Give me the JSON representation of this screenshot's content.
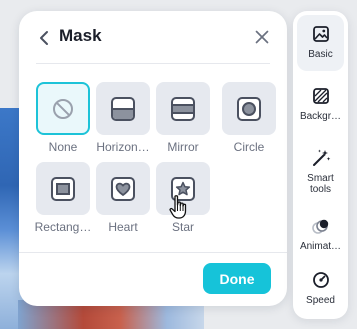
{
  "panel": {
    "title": "Mask",
    "done_label": "Done"
  },
  "masks": [
    {
      "label": "None",
      "icon": "none-icon",
      "selected": true
    },
    {
      "label": "Horizon…",
      "icon": "horizontal-mask-icon"
    },
    {
      "label": "Mirror",
      "icon": "mirror-mask-icon"
    },
    {
      "label": "Circle",
      "icon": "circle-mask-icon"
    },
    {
      "label": "Rectang…",
      "icon": "rectangle-mask-icon"
    },
    {
      "label": "Heart",
      "icon": "heart-mask-icon"
    },
    {
      "label": "Star",
      "icon": "star-mask-icon"
    }
  ],
  "rail": {
    "items": [
      {
        "label": "Basic",
        "icon": "image-icon",
        "active": true
      },
      {
        "label": "Backgr…",
        "icon": "background-icon"
      },
      {
        "label": "Smart tools",
        "icon": "magic-wand-icon"
      },
      {
        "label": "Animat…",
        "icon": "animation-icon"
      },
      {
        "label": "Speed",
        "icon": "speed-icon"
      }
    ]
  },
  "colors": {
    "accent": "#16c3d9",
    "selected_border": "#1dc3d8",
    "tile_bg": "#e6e9ef",
    "icon_stroke": "#4b5160"
  }
}
